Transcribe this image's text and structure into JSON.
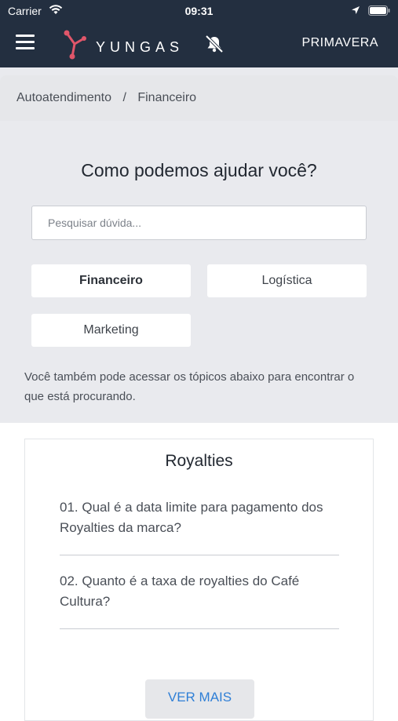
{
  "status": {
    "carrier": "Carrier",
    "time": "09:31"
  },
  "header": {
    "logo_text": "YUNGAS",
    "brand": "PRIMAVERA"
  },
  "breadcrumb": {
    "items": [
      "Autoatendimento",
      "Financeiro"
    ],
    "separator": "/"
  },
  "main": {
    "title": "Como podemos ajudar você?",
    "search_placeholder": "Pesquisar dúvida...",
    "categories": [
      "Financeiro",
      "Logística",
      "Marketing"
    ],
    "helper": "Você também pode acessar os tópicos abaixo para encontrar o que está procurando."
  },
  "topic": {
    "title": "Royalties",
    "questions": [
      "01. Qual é a data limite para pagamento dos Royalties da marca?",
      "02. Quanto é a taxa de royalties do Café Cultura?"
    ],
    "more_label": "VER MAIS"
  },
  "colors": {
    "header_bg": "#232f40",
    "page_bg": "#e9eaee",
    "link": "#2f7fd6"
  },
  "icons": [
    "wifi-icon",
    "location-arrow-icon",
    "battery-icon",
    "menu-icon",
    "yungas-logo-icon",
    "notifications-off-icon"
  ]
}
